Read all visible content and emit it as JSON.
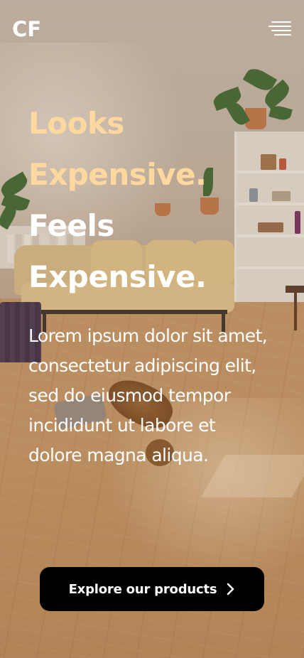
{
  "header": {
    "logo_text": "CF",
    "menu_icon": "hamburger-menu-icon"
  },
  "hero": {
    "headline": [
      {
        "text": "Looks",
        "style": "accent"
      },
      {
        "text": "Expensive.",
        "style": "accent"
      },
      {
        "text": "Feels",
        "style": "plain"
      },
      {
        "text": "Expensive.",
        "style": "plain"
      }
    ],
    "body": "Lorem ipsum dolor sit amet, consectetur adipiscing elit, sed do eiusmod tempor incididunt ut labore et dolore magna aliqua.",
    "cta": {
      "label": "Explore our products",
      "icon": "chevron-right-icon"
    }
  },
  "colors": {
    "accent_text": "#ffd8a0",
    "plain_text": "#ffffff",
    "cta_background": "#000000",
    "cta_text": "#ffffff"
  }
}
